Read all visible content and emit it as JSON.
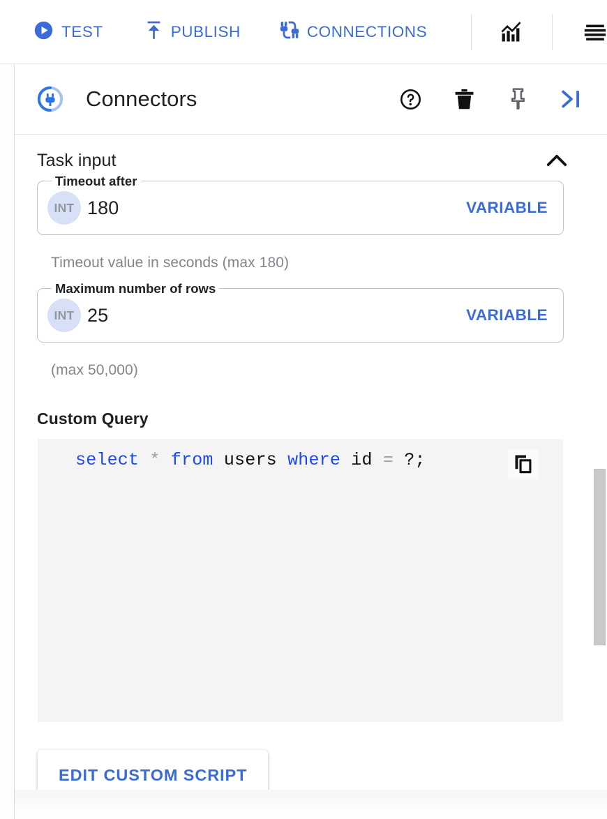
{
  "toolbar": {
    "actions": [
      {
        "label": "TEST",
        "icon": "play-circle-icon"
      },
      {
        "label": "PUBLISH",
        "icon": "publish-upload-icon"
      },
      {
        "label": "CONNECTIONS",
        "icon": "connections-plug-icon"
      }
    ],
    "icons": [
      {
        "name": "analytics-chart-icon"
      },
      {
        "name": "hamburger-menu-icon"
      }
    ],
    "accent_color": "#3b6bd6"
  },
  "panel": {
    "logo_icon": "connectors-plug-logo-icon",
    "title": "Connectors",
    "actions": [
      {
        "name": "help-icon"
      },
      {
        "name": "trash-icon"
      },
      {
        "name": "pin-icon"
      },
      {
        "name": "collapse-right-icon"
      }
    ]
  },
  "task_input": {
    "section_title": "Task input",
    "collapse_icon": "chevron-up-icon",
    "fields": [
      {
        "label": "Timeout after",
        "type_chip": "INT",
        "value": "180",
        "action_label": "VARIABLE",
        "helper": "Timeout value in seconds (max 180)"
      },
      {
        "label": "Maximum number of rows",
        "type_chip": "INT",
        "value": "25",
        "action_label": "VARIABLE",
        "helper": "(max 50,000)"
      }
    ]
  },
  "custom_query": {
    "label": "Custom Query",
    "copy_icon": "copy-icon",
    "code_tokens": [
      {
        "text": "select",
        "kind": "keyword"
      },
      {
        "text": " ",
        "kind": "plain"
      },
      {
        "text": "*",
        "kind": "operator"
      },
      {
        "text": " ",
        "kind": "plain"
      },
      {
        "text": "from",
        "kind": "keyword"
      },
      {
        "text": " ",
        "kind": "plain"
      },
      {
        "text": "users",
        "kind": "identifier"
      },
      {
        "text": " ",
        "kind": "plain"
      },
      {
        "text": "where",
        "kind": "keyword"
      },
      {
        "text": " ",
        "kind": "plain"
      },
      {
        "text": "id",
        "kind": "identifier"
      },
      {
        "text": " ",
        "kind": "plain"
      },
      {
        "text": "=",
        "kind": "operator"
      },
      {
        "text": " ",
        "kind": "plain"
      },
      {
        "text": "?;",
        "kind": "identifier"
      }
    ],
    "code_text": "select * from users where id = ?;"
  },
  "edit_button": {
    "label": "EDIT CUSTOM SCRIPT"
  },
  "colors": {
    "accent_blue": "#3b6bd6",
    "keyword_blue": "#1a4af0",
    "chip_bg": "#d7e0f7",
    "chip_text": "#93989e",
    "code_bg": "#f4f4f5",
    "helper_text": "#80868b",
    "scrollbar_thumb": "#c9c9c9"
  }
}
